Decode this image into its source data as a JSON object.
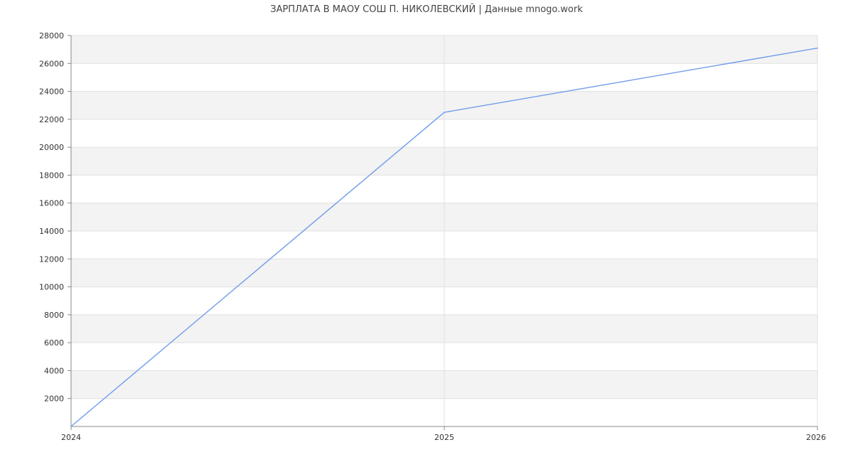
{
  "chart_data": {
    "type": "line",
    "title": "ЗАРПЛАТА В МАОУ СОШ П. НИКОЛЕВСКИЙ | Данные mnogo.work",
    "xlabel": "",
    "ylabel": "",
    "x": [
      "2024",
      "2025",
      "2026"
    ],
    "series": [
      {
        "values": [
          0,
          22500,
          27100
        ]
      }
    ],
    "ylim": [
      0,
      28000
    ],
    "yticks": [
      2000,
      4000,
      6000,
      8000,
      10000,
      12000,
      14000,
      16000,
      18000,
      20000,
      22000,
      24000,
      26000,
      28000
    ],
    "grid": true,
    "banded_background": true,
    "line_color": "#6f9ceb",
    "band_color": "#f3f3f3",
    "grid_color": "#e0e0e0",
    "axis_color": "#888888"
  }
}
